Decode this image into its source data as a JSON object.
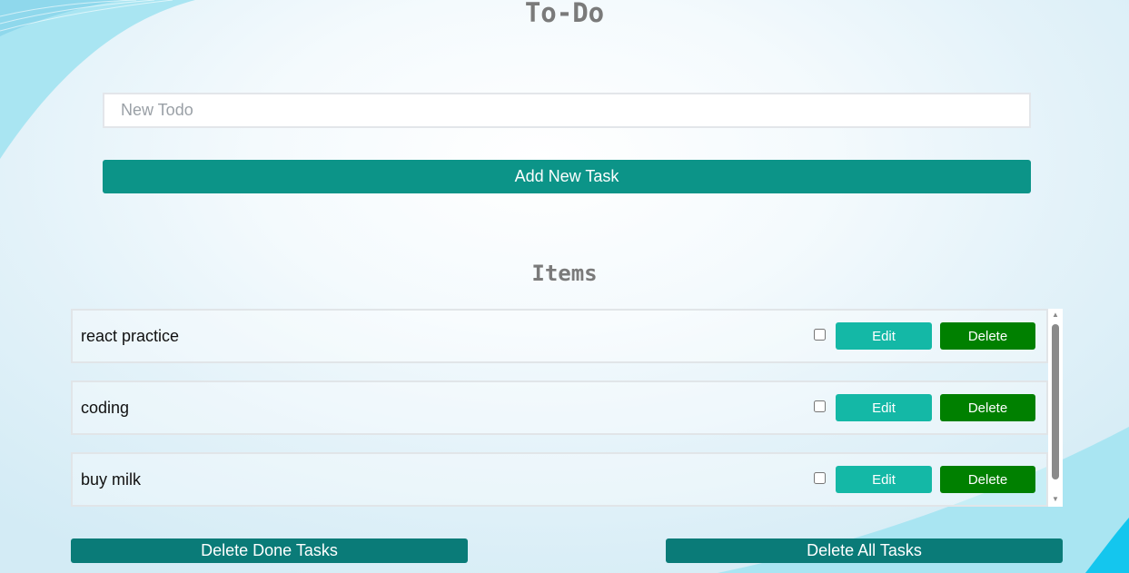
{
  "header": {
    "title": "To-Do"
  },
  "form": {
    "placeholder": "New Todo",
    "value": "",
    "add_label": "Add New Task"
  },
  "items_section": {
    "title": "Items"
  },
  "todos": [
    {
      "text": "react practice",
      "done": false,
      "edit_label": "Edit",
      "delete_label": "Delete"
    },
    {
      "text": "coding",
      "done": false,
      "edit_label": "Edit",
      "delete_label": "Delete"
    },
    {
      "text": "buy milk",
      "done": false,
      "edit_label": "Edit",
      "delete_label": "Delete"
    }
  ],
  "footer": {
    "delete_done_label": "Delete Done Tasks",
    "delete_all_label": "Delete All Tasks"
  },
  "colors": {
    "primary_teal": "#0c9488",
    "edit_teal": "#14b8a6",
    "delete_green": "#008000",
    "footer_teal": "#0a7b78",
    "title_gray": "#7a7a7a"
  },
  "icons": {
    "scroll_up": "scroll-up-arrow-icon",
    "scroll_down": "scroll-down-arrow-icon"
  }
}
